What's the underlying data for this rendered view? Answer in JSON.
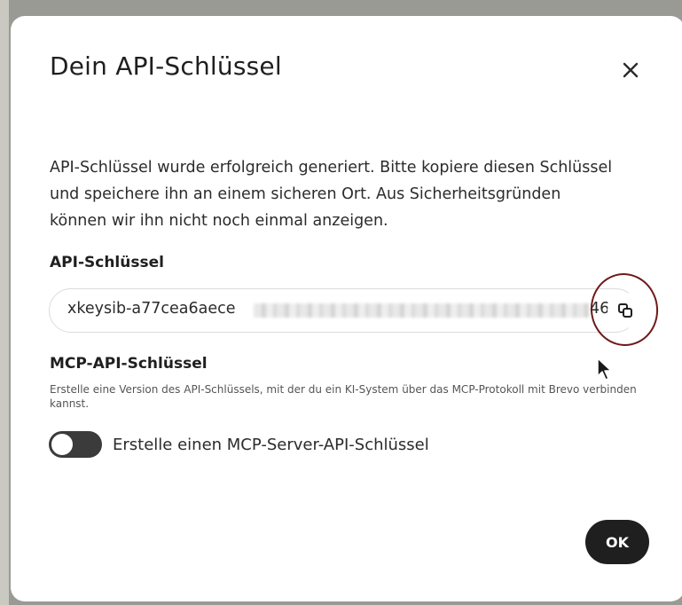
{
  "dialog": {
    "title": "Dein API-Schlüssel",
    "close_icon": "close-icon",
    "description": "API-Schlüssel wurde erfolgreich generiert. Bitte kopiere diesen Schlüssel und speichere ihn an einem sicheren Ort. Aus Sicherheitsgründen können wir ihn nicht noch einmal anzeigen.",
    "api_key": {
      "label": "API-Schlüssel",
      "value_visible_prefix": "xkeysib-a77cea6aece",
      "value_visible_suffix": "46",
      "copy_icon": "copy-icon"
    },
    "mcp": {
      "title": "MCP-API-Schlüssel",
      "description": "Erstelle eine Version des API-Schlüssels, mit der du ein KI-System über das MCP-Protokoll mit Brevo verbinden kannst.",
      "toggle_label": "Erstelle einen MCP-Server-API-Schlüssel",
      "toggle_on": false
    },
    "ok_label": "OK"
  },
  "colors": {
    "backdrop": "#9a9a95",
    "modal_bg": "#ffffff",
    "primary_button": "#1f1f1f",
    "toggle_off": "#3b3b3b",
    "annotation": "#6e1a1a"
  }
}
